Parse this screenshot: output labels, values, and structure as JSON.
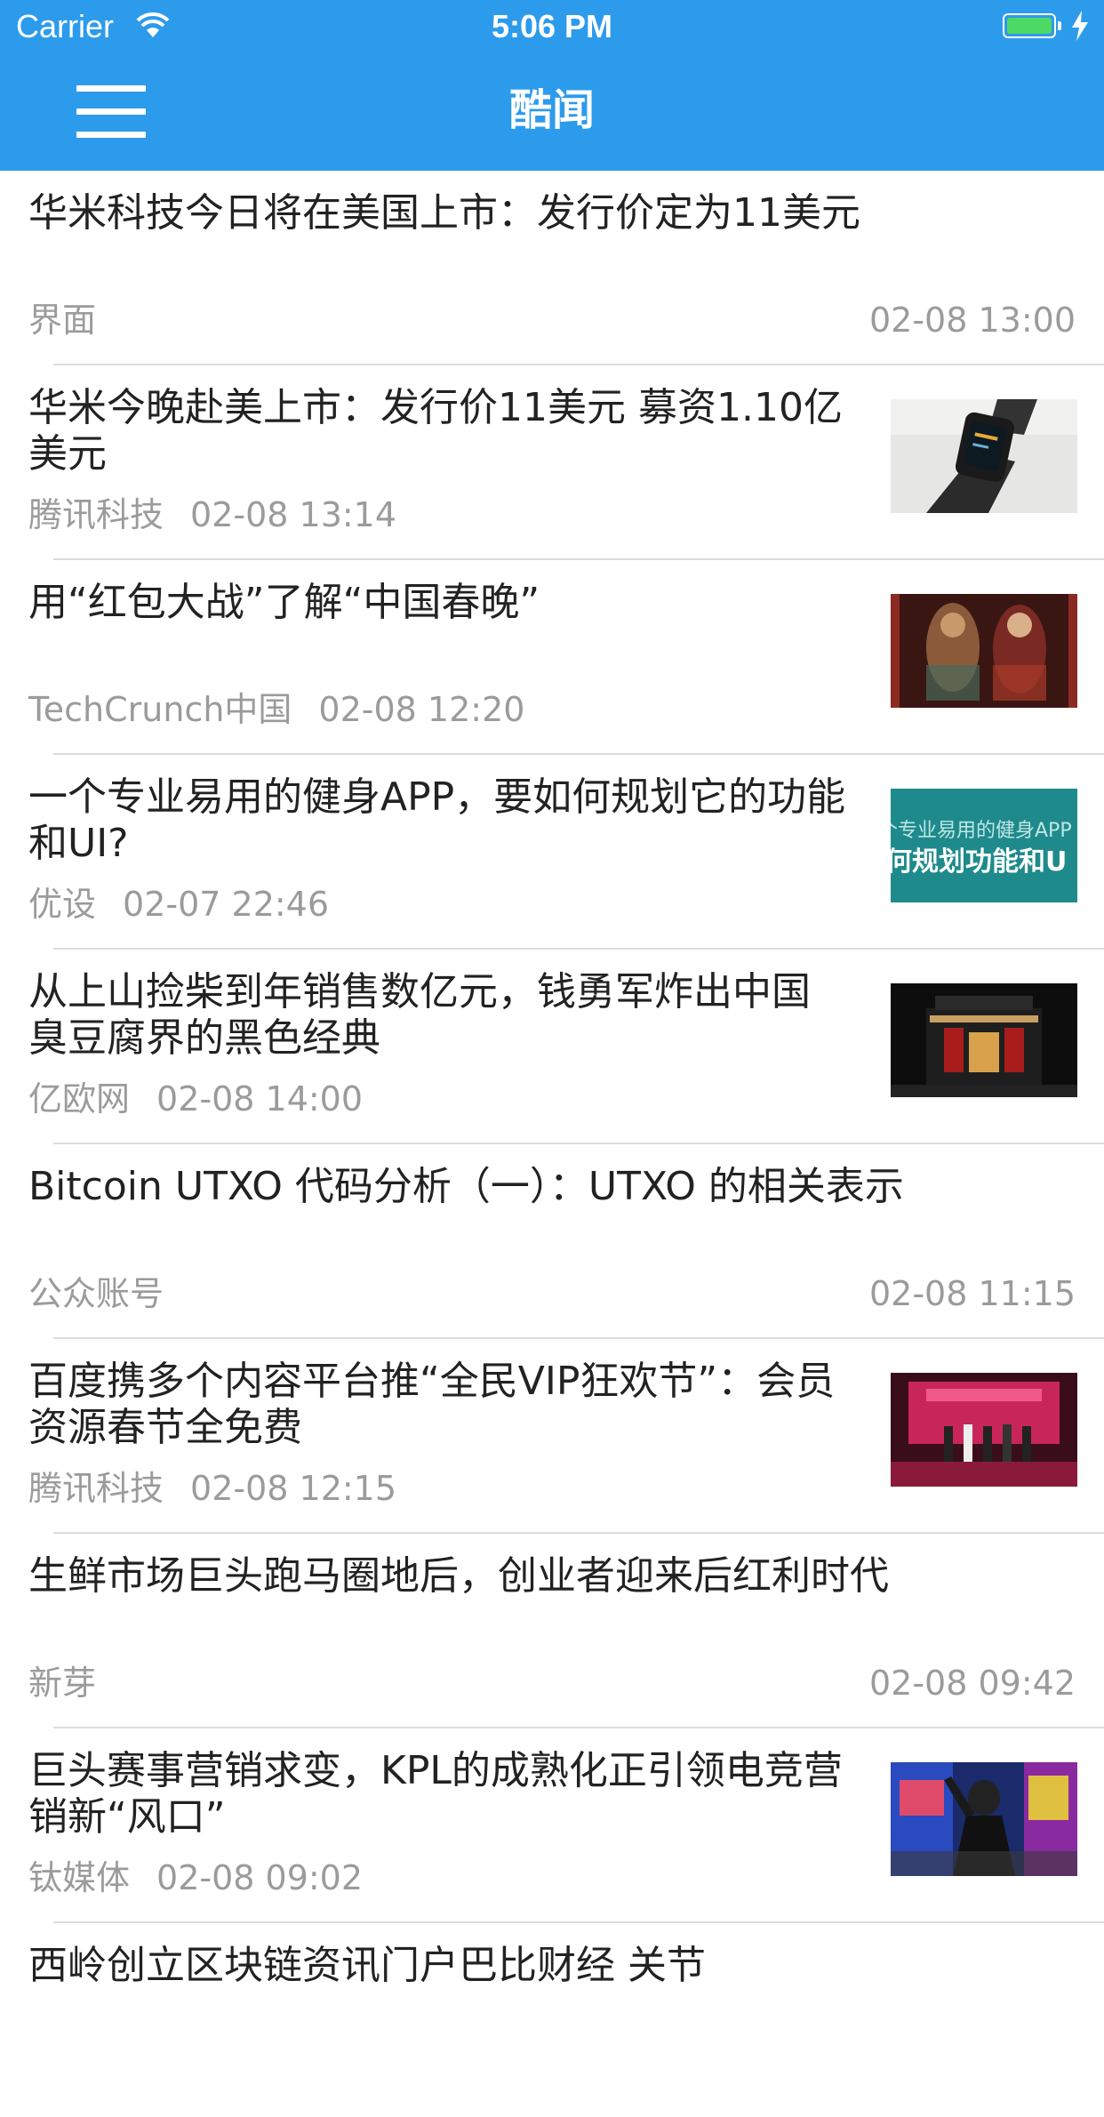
{
  "status_bar": {
    "carrier": "Carrier",
    "time": "5:06 PM",
    "battery_color": "#4cd964"
  },
  "nav": {
    "title": "酷闻",
    "background": "#2d9bec"
  },
  "items": [
    {
      "title": "华米科技今日将在美国上市：发行价定为11美元",
      "source": "界面",
      "time": "02-08 13:00",
      "has_image": false
    },
    {
      "title": "华米今晚赴美上市：发行价11美元 募资1.10亿美元",
      "source": "腾讯科技",
      "time": "02-08 13:14",
      "has_image": true,
      "image": "smartwatch-photo"
    },
    {
      "title": "用“红包大战”了解“中国春晚”",
      "source": "TechCrunch中国",
      "time": "02-08 12:20",
      "has_image": true,
      "image": "chinese-painting"
    },
    {
      "title": "一个专业易用的健身APP，要如何规划它的功能和UI?",
      "source": "优设",
      "time": "02-07 22:46",
      "has_image": true,
      "image": "banner-teal",
      "image_text_1": "个专业易用的健身APP",
      "image_text_2": "何规划功能和U"
    },
    {
      "title": "从上山捡柴到年销售数亿元，钱勇军炸出中国臭豆腐界的黑色经典",
      "source": "亿欧网",
      "time": "02-08 14:00",
      "has_image": true,
      "image": "storefront-photo"
    },
    {
      "title": "Bitcoin UTXO 代码分析（一）：UTXO 的相关表示",
      "source": "公众账号",
      "time": "02-08 11:15",
      "has_image": false
    },
    {
      "title": "百度携多个内容平台推“全民VIP狂欢节”：会员资源春节全免费",
      "source": "腾讯科技",
      "time": "02-08 12:15",
      "has_image": true,
      "image": "event-stage-photo"
    },
    {
      "title": "生鲜市场巨头跑马圈地后，创业者迎来后红利时代",
      "source": "新芽",
      "time": "02-08 09:42",
      "has_image": false
    },
    {
      "title": "巨头赛事营销求变，KPL的成熟化正引领电竞营销新“风口”",
      "source": "钛媒体",
      "time": "02-08 09:02",
      "has_image": true,
      "image": "esports-photo"
    },
    {
      "title": "西岭创立区块链资讯门户巴比财经 关节",
      "source": "",
      "time": "",
      "has_image": false
    }
  ]
}
